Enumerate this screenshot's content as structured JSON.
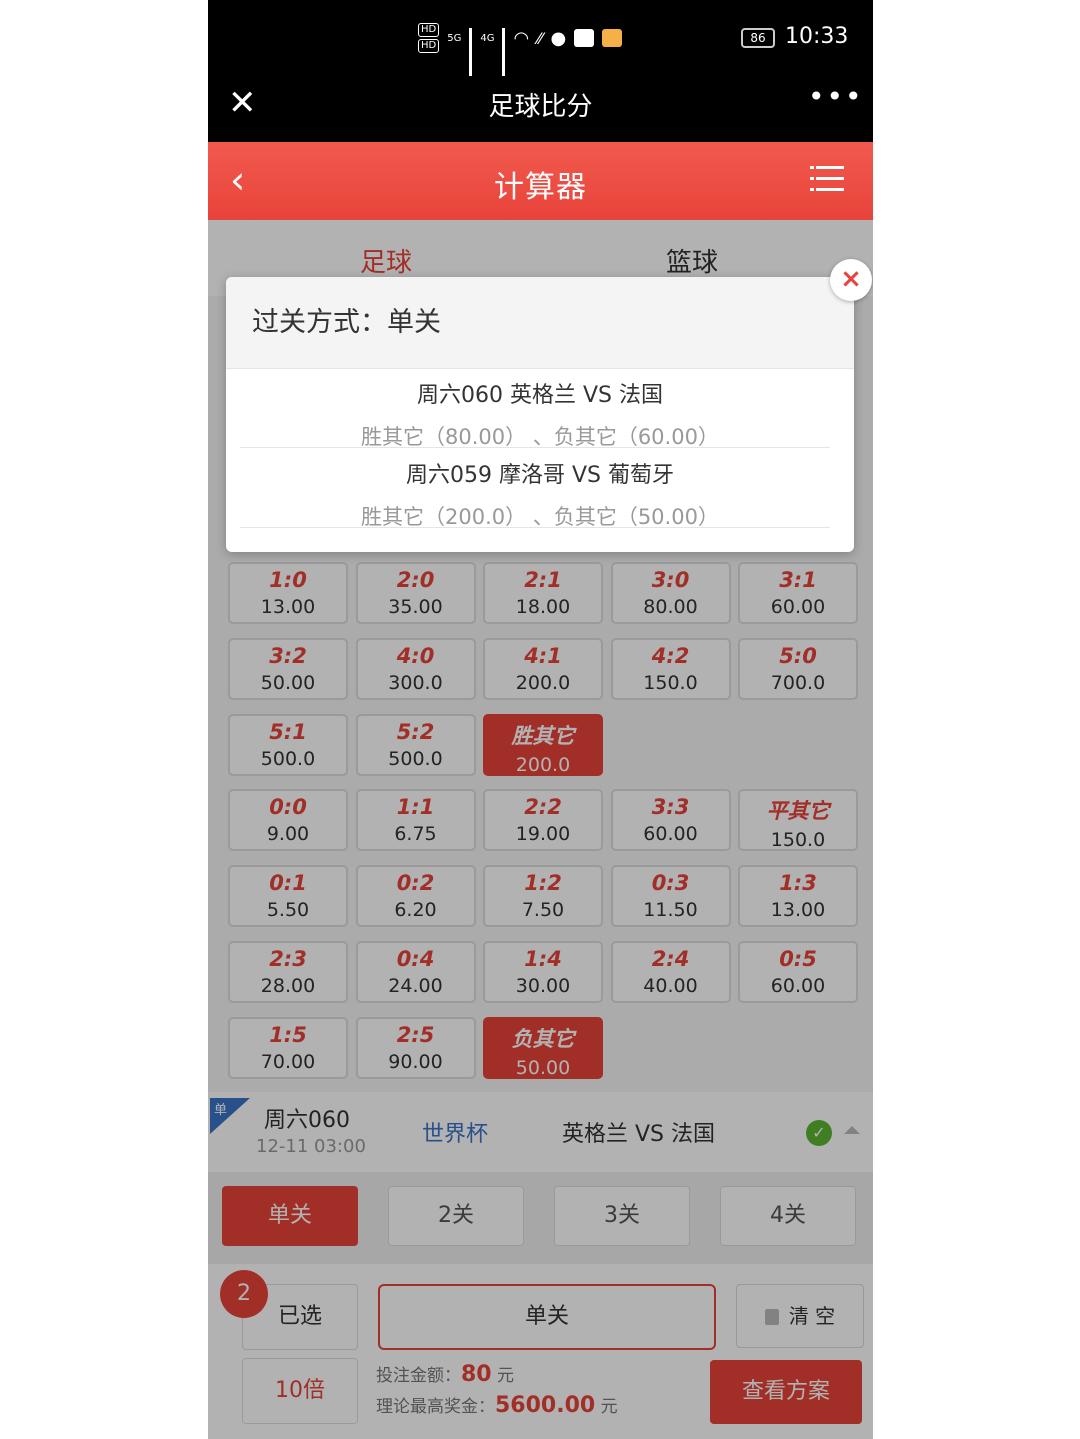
{
  "status_bar": {
    "hd1": "HD",
    "hd2": "HD",
    "net1": "5G",
    "net2": "4G",
    "battery": "86",
    "time": "10:33"
  },
  "title_bar": {
    "title": "足球比分"
  },
  "header": {
    "title": "计算器"
  },
  "sport_tabs": [
    "足球",
    "篮球"
  ],
  "modal": {
    "title": "过关方式：单关",
    "items": [
      {
        "match": "周六060 英格兰 VS 法国",
        "picks": "胜其它（80.00） 、负其它（60.00）"
      },
      {
        "match": "周六059 摩洛哥 VS 葡萄牙",
        "picks": "胜其它（200.0） 、负其它（50.00）"
      }
    ]
  },
  "score_grid": {
    "rows": [
      [
        {
          "score": "1:0",
          "odds": "13.00"
        },
        {
          "score": "2:0",
          "odds": "35.00"
        },
        {
          "score": "2:1",
          "odds": "18.00"
        },
        {
          "score": "3:0",
          "odds": "80.00"
        },
        {
          "score": "3:1",
          "odds": "60.00"
        }
      ],
      [
        {
          "score": "3:2",
          "odds": "50.00"
        },
        {
          "score": "4:0",
          "odds": "300.0"
        },
        {
          "score": "4:1",
          "odds": "200.0"
        },
        {
          "score": "4:2",
          "odds": "150.0"
        },
        {
          "score": "5:0",
          "odds": "700.0"
        }
      ],
      [
        {
          "score": "5:1",
          "odds": "500.0"
        },
        {
          "score": "5:2",
          "odds": "500.0"
        },
        {
          "score": "胜其它",
          "odds": "200.0",
          "selected": true
        }
      ],
      [
        {
          "score": "0:0",
          "odds": "9.00"
        },
        {
          "score": "1:1",
          "odds": "6.75"
        },
        {
          "score": "2:2",
          "odds": "19.00"
        },
        {
          "score": "3:3",
          "odds": "60.00"
        },
        {
          "score": "平其它",
          "odds": "150.0"
        }
      ],
      [
        {
          "score": "0:1",
          "odds": "5.50"
        },
        {
          "score": "0:2",
          "odds": "6.20"
        },
        {
          "score": "1:2",
          "odds": "7.50"
        },
        {
          "score": "0:3",
          "odds": "11.50"
        },
        {
          "score": "1:3",
          "odds": "13.00"
        }
      ],
      [
        {
          "score": "2:3",
          "odds": "28.00"
        },
        {
          "score": "0:4",
          "odds": "24.00"
        },
        {
          "score": "1:4",
          "odds": "30.00"
        },
        {
          "score": "2:4",
          "odds": "40.00"
        },
        {
          "score": "0:5",
          "odds": "60.00"
        }
      ],
      [
        {
          "score": "1:5",
          "odds": "70.00"
        },
        {
          "score": "2:5",
          "odds": "90.00"
        },
        {
          "score": "负其它",
          "odds": "50.00",
          "selected": true
        }
      ]
    ]
  },
  "match_row": {
    "flag": "单",
    "code": "周六060",
    "time": "12-11 03:00",
    "league": "世界杯",
    "teams": "英格兰  VS  法国"
  },
  "pass_tabs": [
    "单关",
    "2关",
    "3关",
    "4关"
  ],
  "bottom": {
    "count": "2",
    "selected_label": "已选",
    "pass_display": "单关",
    "clear_label": "清 空",
    "multiplier": "10倍",
    "bet_amount_label": "投注金额：",
    "bet_amount": "80",
    "unit": "元",
    "max_prize_label": "理论最高奖金：",
    "max_prize": "5600.00",
    "view_plan": "查看方案"
  },
  "colors": {
    "accent": "#e8433a",
    "league": "#3a73c8",
    "check": "#5cb531"
  }
}
